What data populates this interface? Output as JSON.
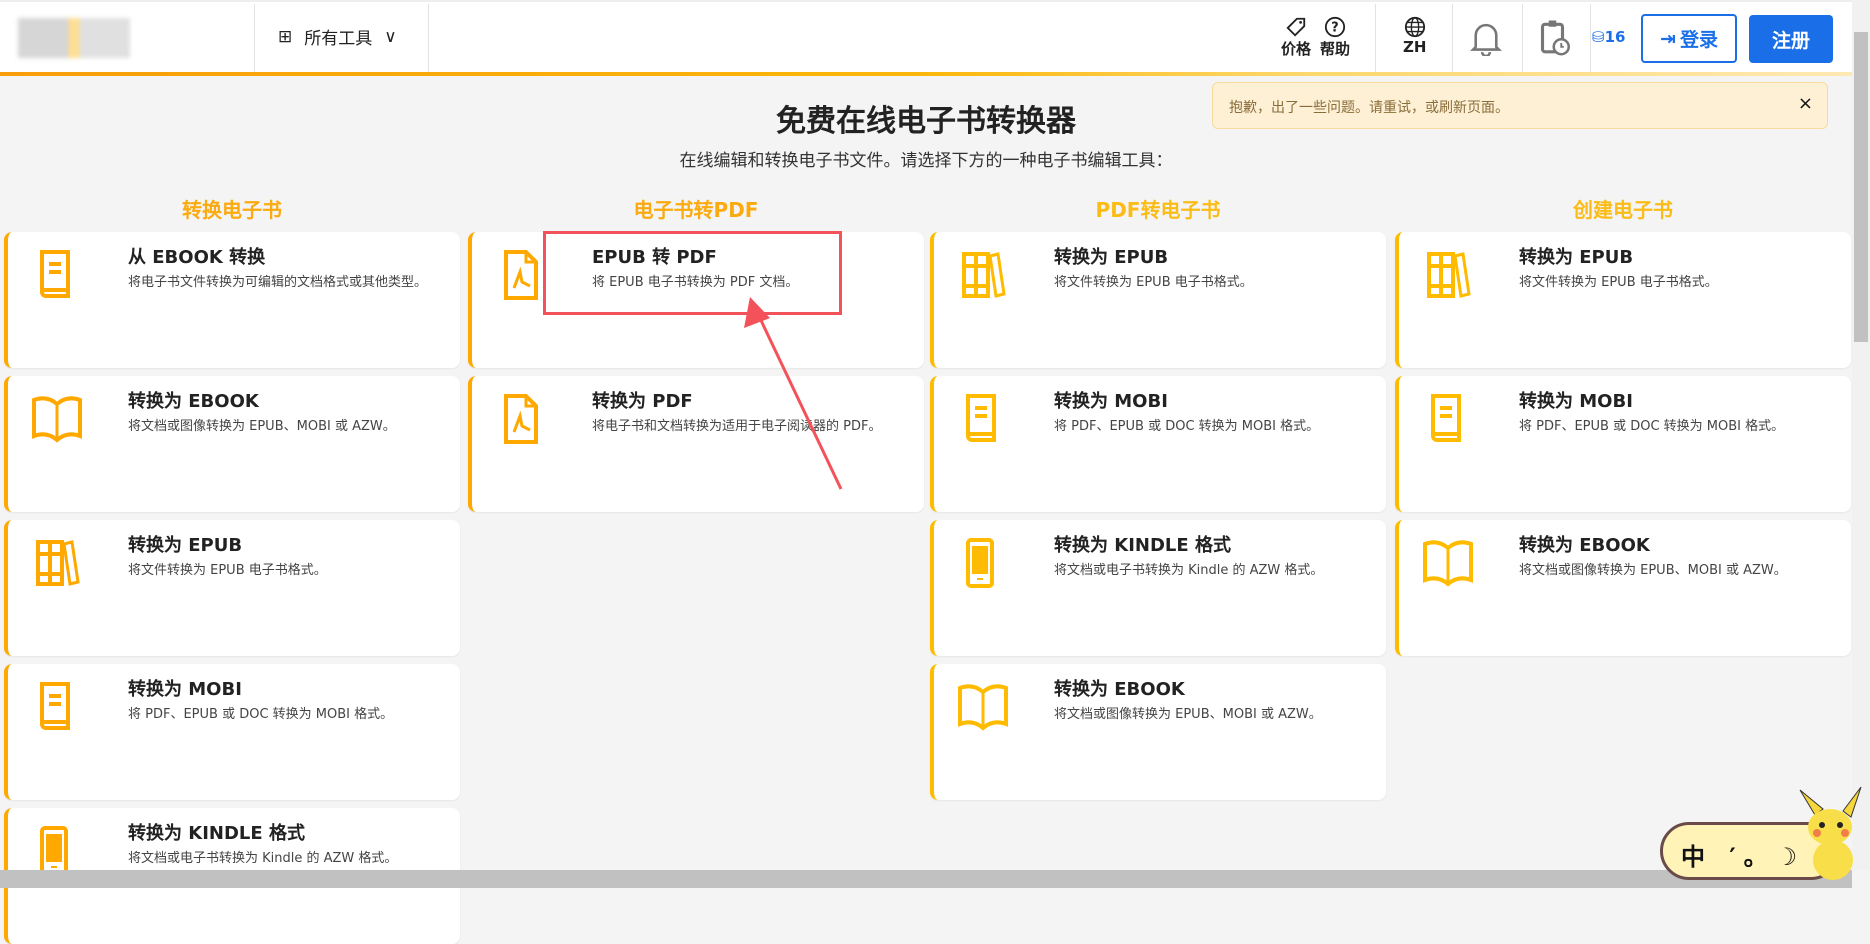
{
  "header": {
    "all_tools": "所有工具",
    "price": "价格",
    "help": "帮助",
    "lang": "ZH",
    "coins": "16",
    "login": "登录",
    "register": "注册"
  },
  "alert": {
    "message": "抱歉，出了一些问题。请重试，或刷新页面。",
    "close": "×"
  },
  "page": {
    "title": "免费在线电子书转换器",
    "subtitle": "在线编辑和转换电子书文件。请选择下方的一种电子书编辑工具："
  },
  "columns": [
    {
      "heading": "转换电子书",
      "cards": [
        {
          "title": "从 EBOOK 转换",
          "desc": "将电子书文件转换为可编辑的文档格式或其他类型。",
          "icon": "book-icon"
        },
        {
          "title": "转换为 EBOOK",
          "desc": "将文档或图像转换为 EPUB、MOBI 或 AZW。",
          "icon": "open-book-icon"
        },
        {
          "title": "转换为 EPUB",
          "desc": "将文件转换为 EPUB 电子书格式。",
          "icon": "books-icon"
        },
        {
          "title": "转换为 MOBI",
          "desc": "将 PDF、EPUB 或 DOC 转换为 MOBI 格式。",
          "icon": "book-icon"
        },
        {
          "title": "转换为 KINDLE 格式",
          "desc": "将文档或电子书转换为 Kindle 的 AZW 格式。",
          "icon": "kindle-icon"
        }
      ]
    },
    {
      "heading": "电子书转PDF",
      "cards": [
        {
          "title": "EPUB 转 PDF",
          "desc": "将 EPUB 电子书转换为 PDF 文档。",
          "icon": "pdf-icon"
        },
        {
          "title": "转换为 PDF",
          "desc": "将电子书和文档转换为适用于电子阅读器的 PDF。",
          "icon": "pdf-icon"
        }
      ]
    },
    {
      "heading": "PDF转电子书",
      "cards": [
        {
          "title": "转换为 EPUB",
          "desc": "将文件转换为 EPUB 电子书格式。",
          "icon": "books-icon"
        },
        {
          "title": "转换为 MOBI",
          "desc": "将 PDF、EPUB 或 DOC 转换为 MOBI 格式。",
          "icon": "book-icon"
        },
        {
          "title": "转换为 KINDLE 格式",
          "desc": "将文档或电子书转换为 Kindle 的 AZW 格式。",
          "icon": "kindle-icon"
        },
        {
          "title": "转换为 EBOOK",
          "desc": "将文档或图像转换为 EPUB、MOBI 或 AZW。",
          "icon": "open-book-icon"
        }
      ]
    },
    {
      "heading": "创建电子书",
      "cards": [
        {
          "title": "转换为 EPUB",
          "desc": "将文件转换为 EPUB 电子书格式。",
          "icon": "books-icon"
        },
        {
          "title": "转换为 MOBI",
          "desc": "将 PDF、EPUB 或 DOC 转换为 MOBI 格式。",
          "icon": "book-icon"
        },
        {
          "title": "转换为 EBOOK",
          "desc": "将文档或图像转换为 EPUB、MOBI 或 AZW。",
          "icon": "open-book-icon"
        }
      ]
    }
  ],
  "ime": {
    "label": "中 ′。☽"
  },
  "colors": {
    "accent": "#ffa800",
    "primary": "#1a6fe8",
    "annotation": "#f4525a"
  }
}
